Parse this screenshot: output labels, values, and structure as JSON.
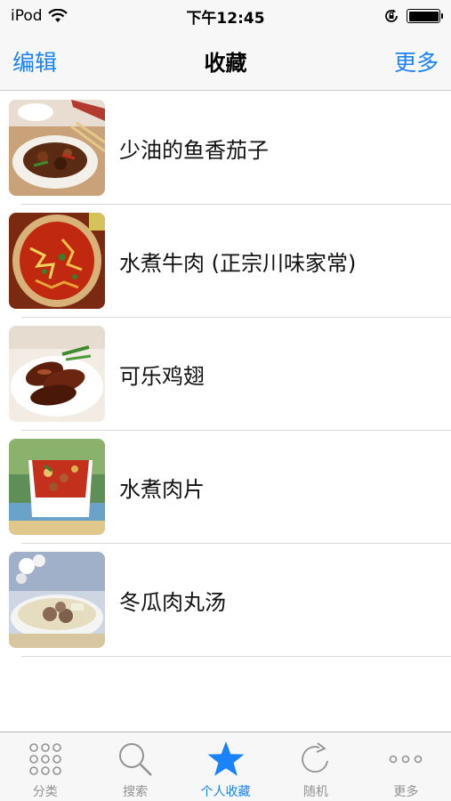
{
  "status": {
    "device": "iPod",
    "time": "下午12:45"
  },
  "nav": {
    "left": "编辑",
    "title": "收藏",
    "right": "更多"
  },
  "favorites": [
    {
      "name": "少油的鱼香茄子",
      "image": "eggplant-dish"
    },
    {
      "name": "水煮牛肉 (正宗川味家常)",
      "image": "boiled-beef-dish"
    },
    {
      "name": "可乐鸡翅",
      "image": "cola-chicken-wings"
    },
    {
      "name": "水煮肉片",
      "image": "boiled-pork-slices"
    },
    {
      "name": "冬瓜肉丸汤",
      "image": "winter-melon-meatball-soup"
    }
  ],
  "tabs": [
    {
      "label": "分类",
      "icon": "grid-icon"
    },
    {
      "label": "搜索",
      "icon": "search-icon"
    },
    {
      "label": "个人收藏",
      "icon": "star-icon"
    },
    {
      "label": "随机",
      "icon": "refresh-icon"
    },
    {
      "label": "更多",
      "icon": "more-icon"
    }
  ],
  "active_tab": "个人收藏",
  "colors": {
    "accent": "#1a82fb",
    "tab_inactive": "#929292",
    "bar_bg": "#f7f7f7"
  }
}
